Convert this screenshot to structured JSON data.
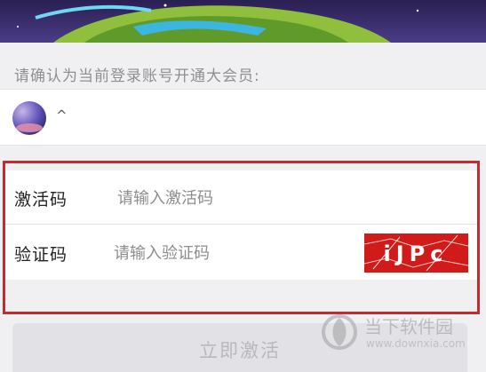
{
  "confirm_prompt": "请确认为当前登录账号开通大会员:",
  "account": {
    "name": "^"
  },
  "form": {
    "activation_code": {
      "label": "激活码",
      "placeholder": "请输入激活码"
    },
    "captcha": {
      "label": "验证码",
      "placeholder": "请输入验证码",
      "image_text": "iJPc"
    }
  },
  "activate_button": {
    "label": "立即激活"
  },
  "watermark": {
    "title": "当下软件园",
    "url": "www.downxia.com"
  },
  "colors": {
    "highlight_border": "#c9282f",
    "captcha_bg": "#d11a1a",
    "button_bg": "#e2e2e6",
    "button_text": "#b9b9bd"
  }
}
